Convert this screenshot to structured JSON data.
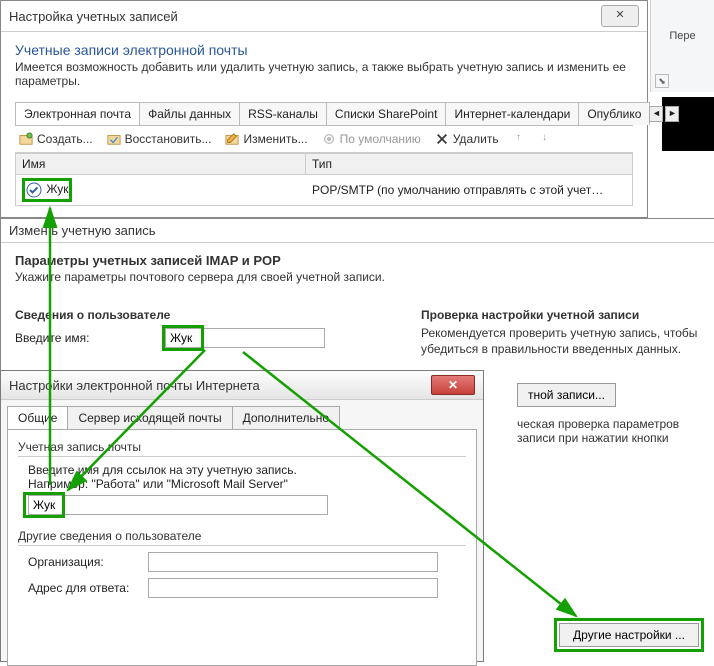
{
  "ribbon": {
    "group_label": "Пере",
    "expand_tip": "⬊"
  },
  "dialog1": {
    "title": "Настройка учетных записей",
    "close": "✕",
    "header": "Учетные записи электронной почты",
    "subheader": "Имеется возможность добавить или удалить учетную запись, а также выбрать учетную запись и изменить ее параметры.",
    "tabs": [
      "Электронная почта",
      "Файлы данных",
      "RSS-каналы",
      "Списки SharePoint",
      "Интернет-календари",
      "Опублико"
    ],
    "spin_left": "◄",
    "spin_right": "►",
    "tools": {
      "create": "Создать...",
      "repair": "Восстановить...",
      "change": "Изменить...",
      "default": "По умолчанию",
      "delete": "Удалить",
      "up": "↑",
      "down": "↓"
    },
    "cols": {
      "name": "Имя",
      "type": "Тип"
    },
    "row": {
      "name": "Жук",
      "type": "POP/SMTP (по умолчанию отправлять с этой учет…"
    }
  },
  "dialog2": {
    "title": "Измен   ь учетную запись",
    "header": "Параметры учетных записей IMAP и POP",
    "subheader": "Укажите параметры почтового сервера для своей учетной записи.",
    "user_section": "Сведения о пользователе",
    "enter_name_label": "Введите имя:",
    "name_value": "Жук",
    "test_section": "Проверка настройки учетной записи",
    "test_desc": "Рекомендуется проверить учетную запись, чтобы убедиться в правильности введенных данных.",
    "test_btn_fragment": "тной записи...",
    "auto_test_fragment1": "ческая проверка параметров",
    "auto_test_fragment2": "записи при нажатии кнопки",
    "more_settings": "Другие настройки ..."
  },
  "dialog3": {
    "title": "Настройки электронной почты Интернета",
    "close": "✕",
    "tabs": [
      "Общие",
      "Сервер исходящей почты",
      "Дополнительно"
    ],
    "group_account": "Учетная запись почты",
    "account_hint1": "Введите имя для ссылок на эту учетную запись.",
    "account_hint2": "Например: \"Работа\" или \"Microsoft Mail Server\"",
    "account_value": "Жук",
    "group_other": "Другие сведения о пользователе",
    "org_label": "Организация:",
    "reply_label": "Адрес для ответа:"
  }
}
